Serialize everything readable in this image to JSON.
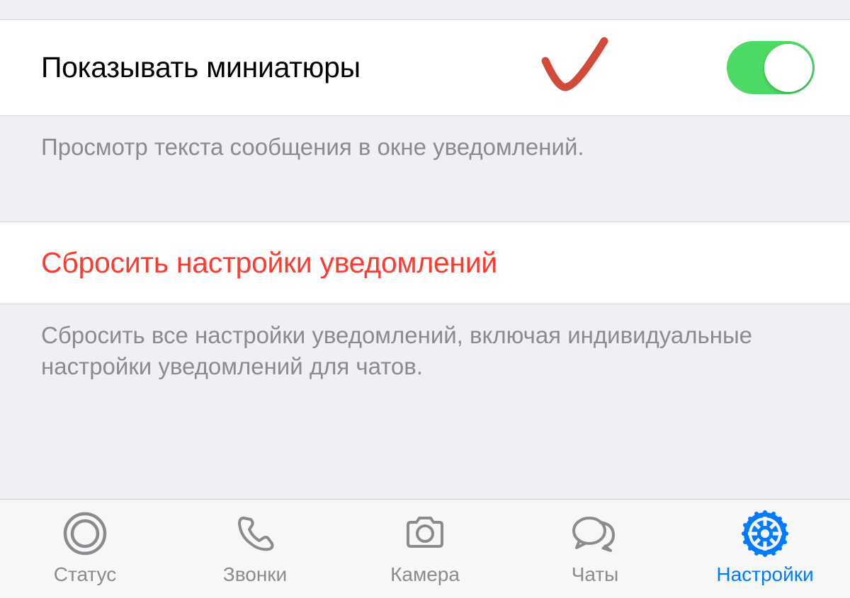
{
  "settings": {
    "show_thumbnails": {
      "label": "Показывать миниатюры",
      "footer": "Просмотр текста сообщения в окне уведомлений.",
      "enabled": true
    },
    "reset": {
      "label": "Сбросить настройки уведомлений",
      "footer": "Сбросить все настройки уведомлений, включая индивидуальные настройки уведомлений для чатов."
    }
  },
  "tabbar": {
    "items": [
      {
        "label": "Статус",
        "icon": "status-icon",
        "active": false
      },
      {
        "label": "Звонки",
        "icon": "phone-icon",
        "active": false
      },
      {
        "label": "Камера",
        "icon": "camera-icon",
        "active": false
      },
      {
        "label": "Чаты",
        "icon": "chats-icon",
        "active": false
      },
      {
        "label": "Настройки",
        "icon": "settings-icon",
        "active": true
      }
    ]
  },
  "colors": {
    "accent": "#007aff",
    "destructive": "#ff3b30",
    "switch_on": "#4cd964",
    "annotation": "#d24a3a"
  }
}
